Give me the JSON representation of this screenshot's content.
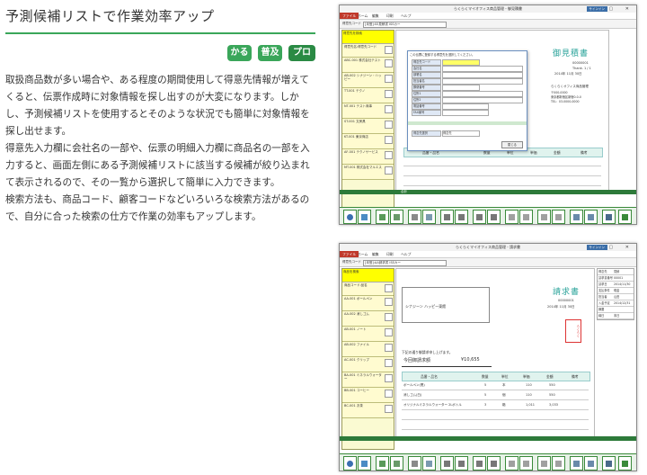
{
  "heading": "予測候補リストで作業効率アップ",
  "tags": [
    {
      "label": "かる",
      "color": "#3aa65a"
    },
    {
      "label": "普及",
      "color": "#3aa65a"
    },
    {
      "label": "プロ",
      "color": "#2a8a44"
    }
  ],
  "description": {
    "p1": "取扱商品数が多い場合や、ある程度の期間使用して得意先情報が増えてくると、伝票作成時に対象情報を探し出すのが大変になります。しかし、予測候補リストを使用するとそのような状況でも簡単に対象情報を探し出せます。",
    "p2": "得意先入力欄に会社名の一部や、伝票の明細入力欄に商品名の一部を入力すると、画面左側にある予測候補リストに該当する候補が絞り込まれて表示されるので、その一覧から選択して簡単に入力できます。",
    "p3": "検索方法も、商品コード、顧客コードなどいろいろな検索方法があるので、自分に合った検索の仕方で作業の効率もアップします。"
  },
  "screenshot1": {
    "title": "らくらくマイオフィス商品管理 - 御見積書",
    "signin": "サインイン",
    "menu": [
      "ファイル",
      "ホーム",
      "編集",
      "印刷",
      "ヘルプ"
    ],
    "toolbar_field": "得意先コード",
    "toolbar_value": "[未登]:SS見積書 ISSカー",
    "doc_title": "御見積書",
    "doc_no_label": "No.",
    "doc_no": "00000001",
    "thank": "Thank. 1 / 1",
    "date": "2014年 11月 30日",
    "company": "らくらくオフィス商品管理",
    "zip": "〒000-0000",
    "address": "東京都新宿区新宿0-0-0",
    "tel": "TEL：03-0000-0000",
    "grid_headers": [
      "品番・品名",
      "数量",
      "単位",
      "単価",
      "金額",
      "備考"
    ],
    "dialog_title": "この伝票に登録する得意先を選択してください。",
    "dialog_fields": [
      "得意先コード",
      "会社名",
      "部署名",
      "担当者名",
      "郵便番号",
      "住所1",
      "住所2",
      "電話番号",
      "FAX番号"
    ],
    "dialog_search_label": "得意先選択",
    "dialog_search_value": "得意先",
    "dialog_button": "閉じる",
    "sidebar_header": "得意先を検索",
    "sidebar_items": [
      "得意先名:得意先コード",
      "ABC-001 株式会社テスト",
      "AB-002 シナジーン・ハッピー",
      "TT-001 テクノ",
      "NT-001 テスト商事",
      "ST-001 文房具",
      "KT-001 東京商店",
      "AF-001 テクノサービス",
      "MT-001 株式会社マルエス"
    ],
    "total_label": "合計",
    "bottom_labels": [
      "見積書",
      "送付",
      "印刷"
    ],
    "fkey_labels": [
      "ヘルプ",
      "新規作成",
      "保存",
      "削除",
      "検索",
      "印刷"
    ]
  },
  "screenshot2": {
    "title": "らくらくマイオフィス商品管理 - 請求書",
    "signin": "サインイン",
    "menu": [
      "ファイル",
      "ホーム",
      "編集",
      "印刷",
      "ヘルプ"
    ],
    "toolbar_field": "得意先コード",
    "toolbar_value": "[未登]:AA請求書 ISSカー",
    "doc_title": "請求書",
    "doc_no": "00000001",
    "date": "2014年 11月 30日",
    "customer": "シナジーン ハッピー東館",
    "greeting": "下記の通り御請求申し上げます。",
    "total_label": "今回御請求額",
    "total_value": "¥10,655",
    "grid_headers": [
      "品番・品名",
      "数量",
      "単位",
      "単価",
      "金額",
      "備考"
    ],
    "rows": [
      {
        "name": "ボールペン(黒)",
        "qty": "5",
        "unit": "本",
        "price": "110",
        "amount": "550"
      },
      {
        "name": "消しゴム(白)",
        "qty": "5",
        "unit": "個",
        "price": "110",
        "amount": "550"
      },
      {
        "name": "オリジナルミネラルウォーター 2Lボトル",
        "qty": "3",
        "unit": "箱",
        "price": "1,011",
        "amount": "3,033"
      }
    ],
    "stamp": "らくらく",
    "right_panel": [
      "得意先",
      "請求書番号",
      "請求日",
      "支払条件",
      "担当者",
      "入金予定",
      "摘要",
      "締日"
    ],
    "right_panel_values": [
      "見積",
      "00001",
      "2014/11/30",
      "現金",
      "山田",
      "2014/12/31",
      "",
      "末日"
    ],
    "sidebar_header": "商品を検索",
    "sidebar_items": [
      "商品コード:品名",
      "AA-001 ボールペン",
      "AA-002 消しゴム",
      "AB-001 ノート",
      "AB-002 ファイル",
      "AC-001 クリップ",
      "BA-001 ミネラルウォーター",
      "BB-001 コーヒー",
      "BC-001 お茶"
    ],
    "fkey_labels": [
      "ヘルプ",
      "新規作成",
      "保存",
      "削除",
      "検索",
      "印刷"
    ]
  }
}
